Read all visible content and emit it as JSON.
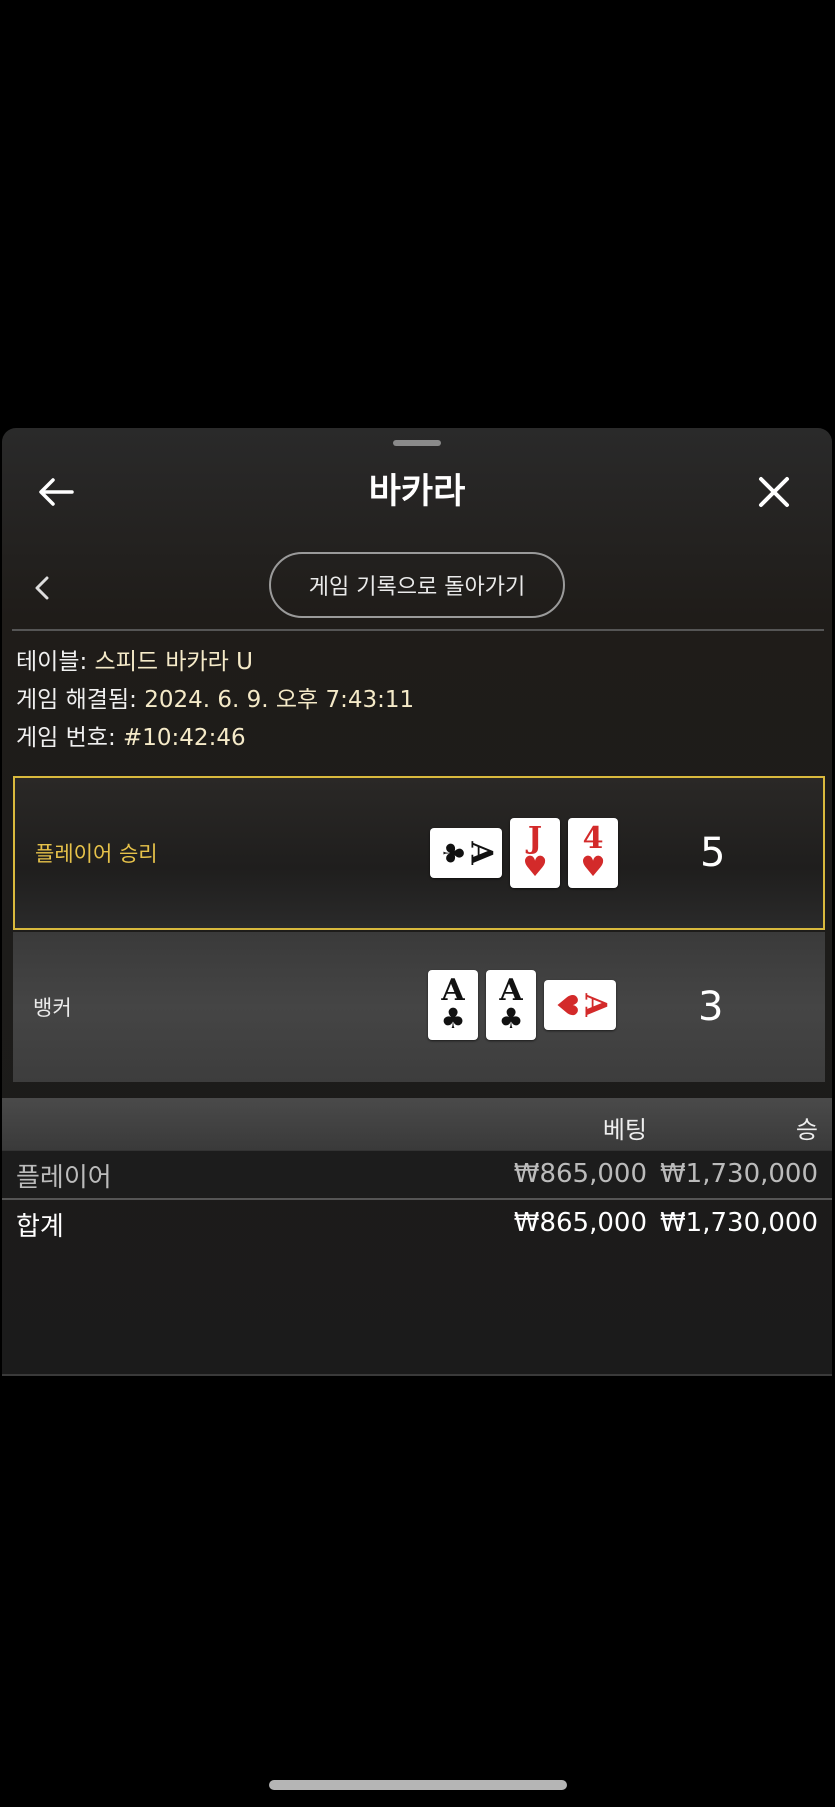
{
  "header": {
    "title": "바카라"
  },
  "nav": {
    "back_to_history_label": "게임 기록으로 돌아가기"
  },
  "info": {
    "table_label": "테이블:",
    "table_value": "스피드 바카라 U",
    "resolved_label": "게임 해결됨:",
    "resolved_value": "2024. 6. 9. 오후 7:43:11",
    "game_no_label": "게임 번호:",
    "game_no_value": "#10:42:46"
  },
  "player": {
    "label": "플레이어 승리",
    "score": "5",
    "cards": [
      {
        "rank": "A",
        "suit": "♣",
        "color": "#111111",
        "orientation": "horizontal"
      },
      {
        "rank": "J",
        "suit": "♥",
        "color": "#d32a2a",
        "orientation": "vertical"
      },
      {
        "rank": "4",
        "suit": "♥",
        "color": "#d32a2a",
        "orientation": "vertical"
      }
    ]
  },
  "banker": {
    "label": "뱅커",
    "score": "3",
    "cards": [
      {
        "rank": "A",
        "suit": "♣",
        "color": "#111111",
        "orientation": "vertical"
      },
      {
        "rank": "A",
        "suit": "♣",
        "color": "#111111",
        "orientation": "vertical"
      },
      {
        "rank": "A",
        "suit": "♥",
        "color": "#d32a2a",
        "orientation": "horizontal"
      }
    ]
  },
  "table": {
    "headers": {
      "bet": "베팅",
      "win": "승"
    },
    "rows": [
      {
        "label": "플레이어",
        "bet": "₩865,000",
        "win": "₩1,730,000"
      }
    ],
    "total": {
      "label": "합계",
      "bet": "₩865,000",
      "win": "₩1,730,000"
    }
  },
  "colors": {
    "accent_gold": "#d9b93d",
    "card_red": "#d32a2a"
  },
  "icons": {
    "back": "arrow-left-icon",
    "close": "close-icon",
    "chevron": "chevron-left-icon"
  }
}
